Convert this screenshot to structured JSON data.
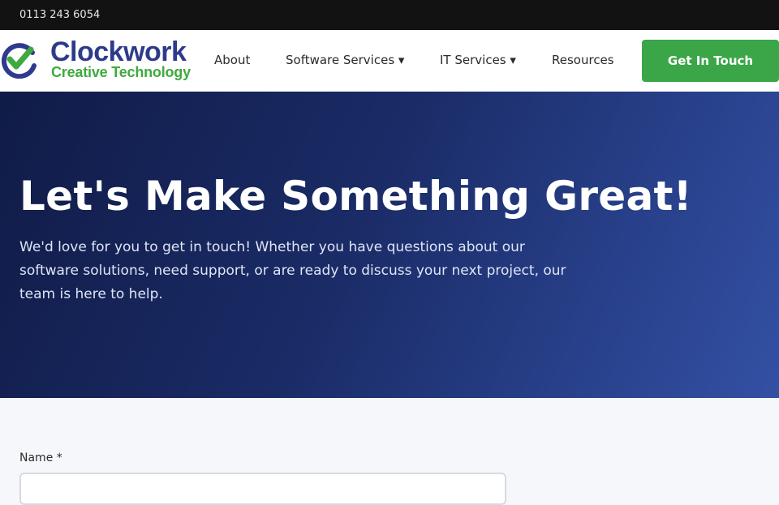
{
  "topbar": {
    "phone": "0113 243 6054"
  },
  "logo": {
    "brand": "Clockwork",
    "tagline": "Creative Technology"
  },
  "nav": {
    "items": [
      {
        "label": "About"
      },
      {
        "label": "Software Services ▾"
      },
      {
        "label": "IT Services ▾"
      },
      {
        "label": "Resources"
      }
    ],
    "cta": "Get In Touch"
  },
  "hero": {
    "title": "Let's Make Something Great!",
    "text": "We'd love for you to get in touch! Whether you have questions about our software solutions, need support, or are ready to discuss your next project, our team is here to help."
  },
  "form": {
    "name_label": "Name *",
    "name_value": ""
  },
  "colors": {
    "brand_blue": "#2e3b8c",
    "brand_green": "#3fa93f",
    "cta_green": "#3aa648",
    "topbar": "#121212"
  }
}
